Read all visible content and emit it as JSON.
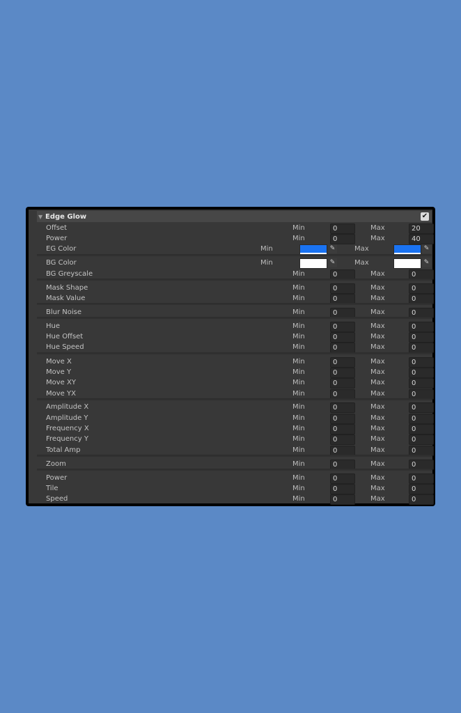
{
  "panel": {
    "title": "Edge Glow",
    "collapse_icon": "triangle-down-icon",
    "enabled_icon": "checkmark-icon",
    "enabled": true
  },
  "labels": {
    "min": "Min",
    "max": "Max"
  },
  "rows": {
    "offset": {
      "label": "Offset",
      "min": "0",
      "max": "20"
    },
    "power": {
      "label": "Power",
      "min": "0",
      "max": "40"
    },
    "eg_color": {
      "label": "EG Color",
      "min_color": "#1a73f2",
      "max_color": "#1a73f2"
    },
    "bg_color": {
      "label": "BG Color",
      "min_color": "#ffffff",
      "max_color": "#ffffff"
    },
    "bg_greyscale": {
      "label": "BG Greyscale",
      "min": "0",
      "max": "0"
    },
    "mask_shape": {
      "label": "Mask Shape",
      "min": "0",
      "max": "0"
    },
    "mask_value": {
      "label": "Mask Value",
      "min": "0",
      "max": "0"
    },
    "blur_noise": {
      "label": "Blur Noise",
      "min": "0",
      "max": "0"
    },
    "hue": {
      "label": "Hue",
      "min": "0",
      "max": "0"
    },
    "hue_offset": {
      "label": "Hue Offset",
      "min": "0",
      "max": "0"
    },
    "hue_speed": {
      "label": "Hue Speed",
      "min": "0",
      "max": "0"
    },
    "move_x": {
      "label": "Move X",
      "min": "0",
      "max": "0"
    },
    "move_y": {
      "label": "Move Y",
      "min": "0",
      "max": "0"
    },
    "move_xy": {
      "label": "Move XY",
      "min": "0",
      "max": "0"
    },
    "move_yx": {
      "label": "Move YX",
      "min": "0",
      "max": "0"
    },
    "amplitude_x": {
      "label": "Amplitude X",
      "min": "0",
      "max": "0"
    },
    "amplitude_y": {
      "label": "Amplitude Y",
      "min": "0",
      "max": "0"
    },
    "frequency_x": {
      "label": "Frequency X",
      "min": "0",
      "max": "0"
    },
    "frequency_y": {
      "label": "Frequency Y",
      "min": "0",
      "max": "0"
    },
    "total_amp": {
      "label": "Total Amp",
      "min": "0",
      "max": "0"
    },
    "zoom": {
      "label": "Zoom",
      "min": "0",
      "max": "0"
    },
    "power2": {
      "label": "Power",
      "min": "0",
      "max": "0"
    },
    "tile": {
      "label": "Tile",
      "min": "0",
      "max": "0"
    },
    "speed": {
      "label": "Speed",
      "min": "0",
      "max": "0"
    }
  },
  "icons": {
    "picker": "eyedropper-icon"
  },
  "colors": {
    "background": "#5b89c6",
    "panel": "#383838",
    "header": "#474747"
  }
}
